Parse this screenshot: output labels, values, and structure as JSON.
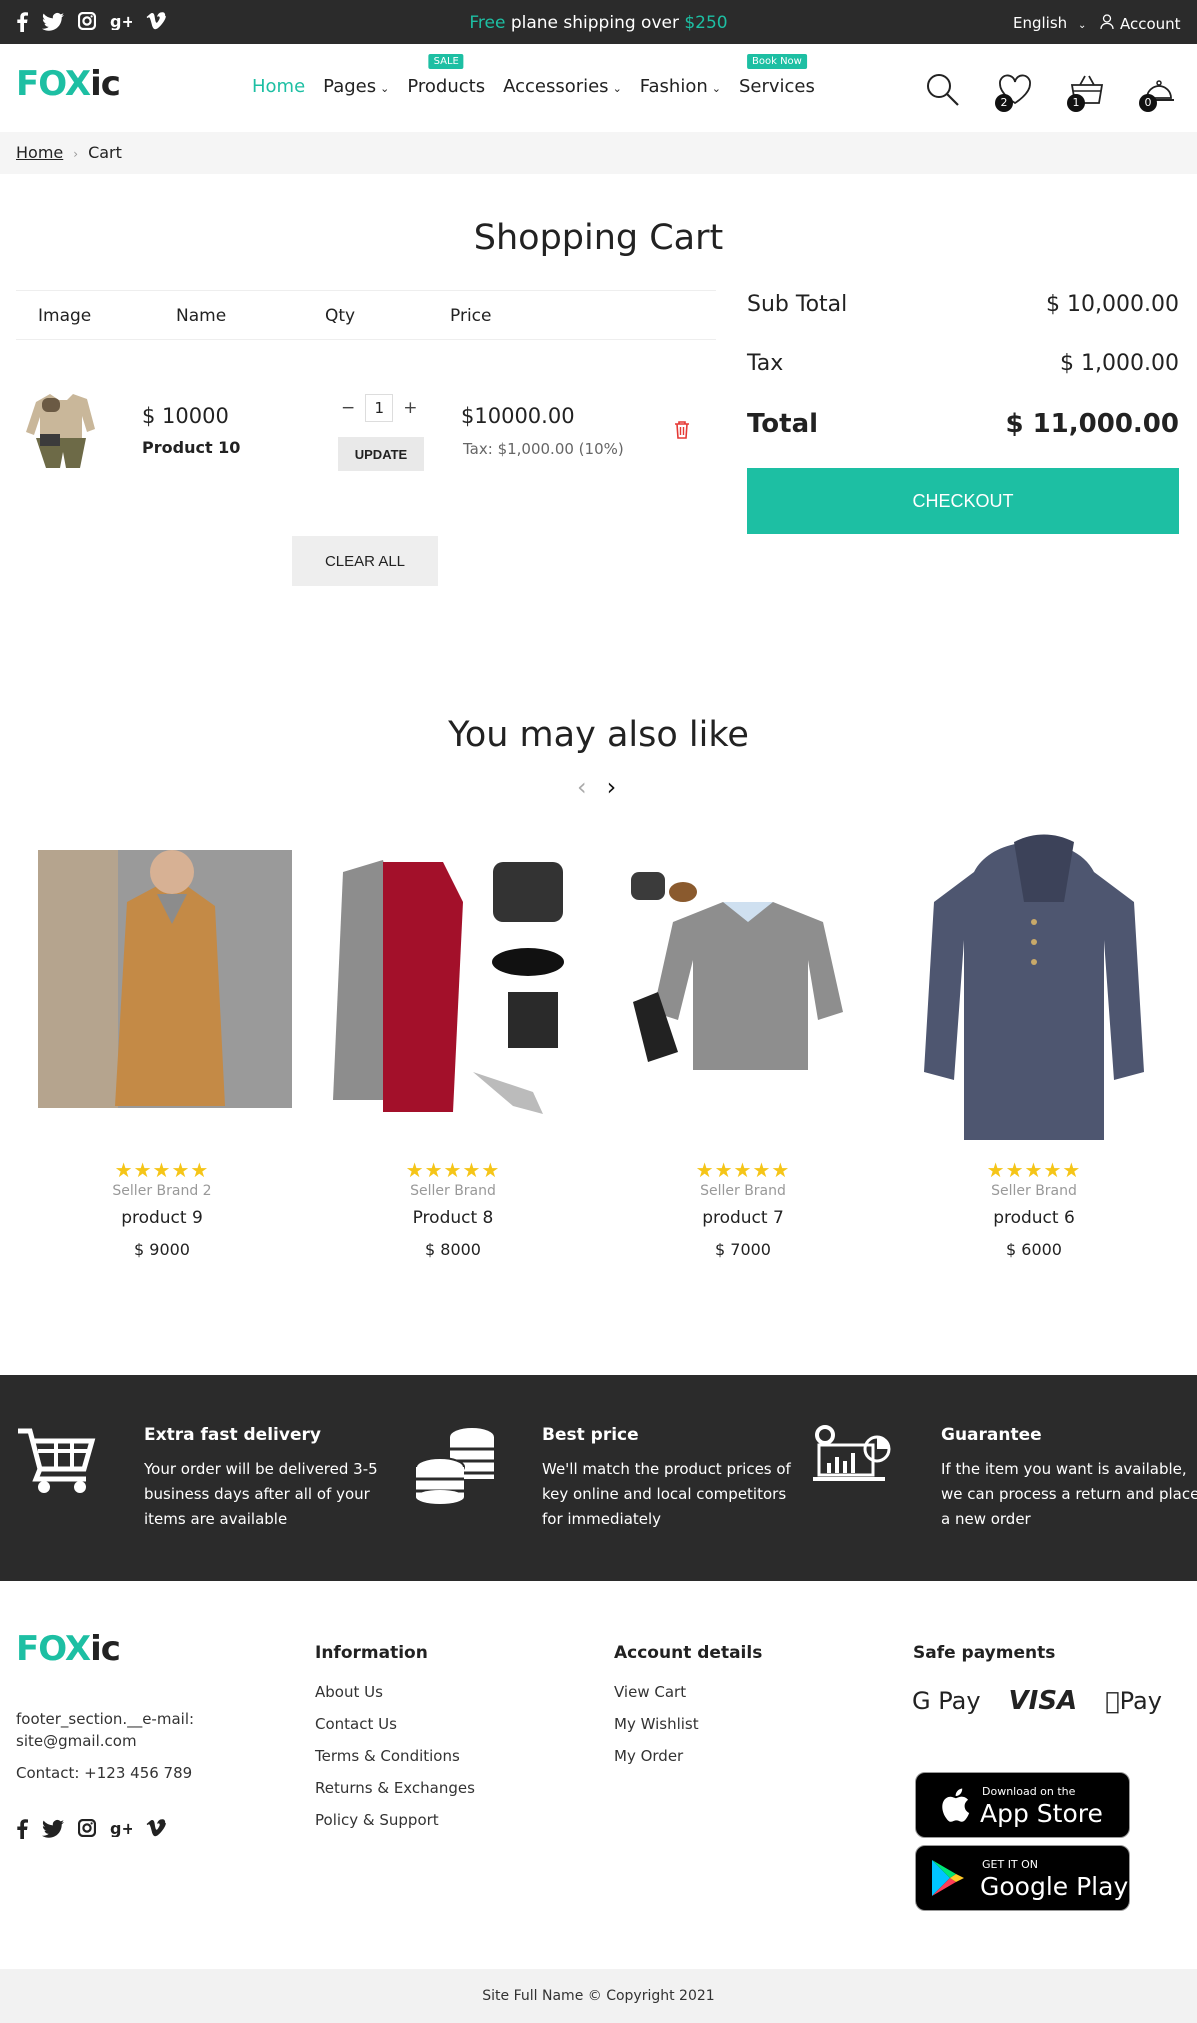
{
  "topbar": {
    "promo_free": "Free",
    "promo_text": "plane shipping over",
    "promo_amount": "$250",
    "language": "English",
    "account": "Account",
    "social_icons": [
      "facebook-icon",
      "twitter-icon",
      "instagram-icon",
      "google-plus-icon",
      "vimeo-icon"
    ]
  },
  "brand": {
    "logo_part1": "FOX",
    "logo_part2": "ic",
    "accent": "#1dbfa3"
  },
  "nav": {
    "home": "Home",
    "pages": "Pages",
    "products": "Products",
    "products_badge": "SALE",
    "accessories": "Accessories",
    "fashion": "Fashion",
    "services": "Services",
    "services_badge": "Book Now"
  },
  "header_icons": {
    "wishlist_count": "2",
    "cart_count": "1",
    "bell_count": "0"
  },
  "breadcrumb": {
    "home": "Home",
    "current": "Cart"
  },
  "cart": {
    "title": "Shopping Cart",
    "columns": {
      "image": "Image",
      "name": "Name",
      "qty": "Qty",
      "price": "Price"
    },
    "item": {
      "price": "$ 10000",
      "name": "Product 10",
      "qty": "1",
      "update": "UPDATE",
      "line_price": "$10000.00",
      "tax": "Tax: $1,000.00 (10%)"
    },
    "clear_all": "CLEAR ALL"
  },
  "summary": {
    "subtotal_label": "Sub Total",
    "subtotal_value": "$ 10,000.00",
    "tax_label": "Tax",
    "tax_value": "$ 1,000.00",
    "total_label": "Total",
    "total_value": "$ 11,000.00",
    "checkout": "CHECKOUT"
  },
  "related": {
    "title": "You may also like",
    "products": [
      {
        "brand": "Seller Brand 2",
        "name": "product 9",
        "price": "$ 9000",
        "rating": 5
      },
      {
        "brand": "Seller Brand",
        "name": "Product 8",
        "price": "$ 8000",
        "rating": 5
      },
      {
        "brand": "Seller Brand",
        "name": "product 7",
        "price": "$ 7000",
        "rating": 5
      },
      {
        "brand": "Seller Brand",
        "name": "product 6",
        "price": "$ 6000",
        "rating": 5
      }
    ],
    "stars": "★★★★★"
  },
  "features": [
    {
      "title": "Extra fast delivery",
      "text": "Your order will be delivered 3-5 business days after all of your items are available",
      "icon": "cart-icon"
    },
    {
      "title": "Best price",
      "text": "We'll match the product prices of key online and local competitors for immediately",
      "icon": "coins-icon"
    },
    {
      "title": "Guarantee",
      "text": "If the item you want is available, we can process a return and place a new order",
      "icon": "analytics-icon"
    }
  ],
  "footer": {
    "about_email": "footer_section.__e-mail: site@gmail.com",
    "contact": "Contact: +123 456 789",
    "information": {
      "heading": "Information",
      "links": [
        "About Us",
        "Contact Us",
        "Terms & Conditions",
        "Returns & Exchanges",
        "Policy & Support"
      ]
    },
    "account": {
      "heading": "Account details",
      "links": [
        "View Cart",
        "My Wishlist",
        "My Order"
      ]
    },
    "payments": {
      "heading": "Safe payments",
      "gpay": "G Pay",
      "visa": "VISA",
      "applepay": "Pay"
    },
    "app_store": {
      "small": "Download on the",
      "big": "App Store"
    },
    "google_play": {
      "small": "GET IT ON",
      "big": "Google Play"
    },
    "copyright": "Site Full Name © Copyright 2021"
  }
}
